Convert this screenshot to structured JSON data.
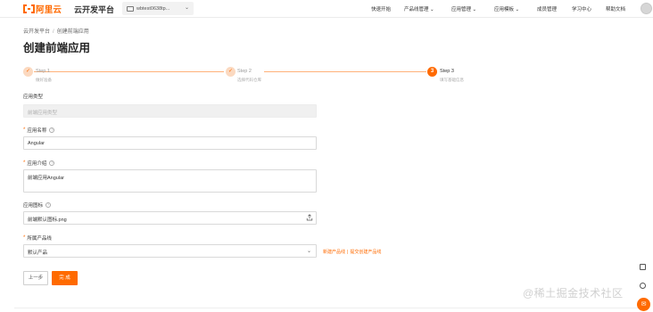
{
  "brand": {
    "logo_text": "阿里云",
    "app_title": "云开发平台"
  },
  "project": {
    "name": "wbtest0638tp..."
  },
  "nav": [
    {
      "label": "快速开始"
    },
    {
      "label": "产品线管理 ⌄"
    },
    {
      "label": "应用管理 ⌄"
    },
    {
      "label": "应用模板 ⌄"
    },
    {
      "label": "成员管理"
    },
    {
      "label": "学习中心"
    },
    {
      "label": "帮助文档"
    }
  ],
  "breadcrumb": {
    "root": "云开发平台",
    "separator": "/",
    "current": "创建前端应用"
  },
  "page_title": "创建前端应用",
  "steps": [
    {
      "title": "Step 1",
      "desc": "做好准备",
      "status": "done",
      "icon": "check-icon"
    },
    {
      "title": "Step 2",
      "desc": "选择代码仓库",
      "status": "done",
      "icon": "check-icon"
    },
    {
      "title": "Step 3",
      "desc": "填写基础信息",
      "status": "active",
      "number": "3"
    }
  ],
  "form": {
    "app_type": {
      "label": "应用类型",
      "placeholder": "前端应用类型"
    },
    "app_name": {
      "label": "应用名称",
      "value": "Angular"
    },
    "app_desc": {
      "label": "应用介绍",
      "value": "前端应用Angular"
    },
    "app_icon": {
      "label": "应用图标",
      "value": "前端默认图标.png"
    },
    "product_line": {
      "label": "所属产品线",
      "value": "默认产品"
    },
    "links": {
      "new": "新建产品线",
      "separator": "|",
      "apply": "提交创建产品线"
    }
  },
  "buttons": {
    "prev": "上一步",
    "finish": "完 成"
  },
  "watermark": "@稀土掘金技术社区",
  "colors": {
    "accent": "#ff6a00"
  }
}
